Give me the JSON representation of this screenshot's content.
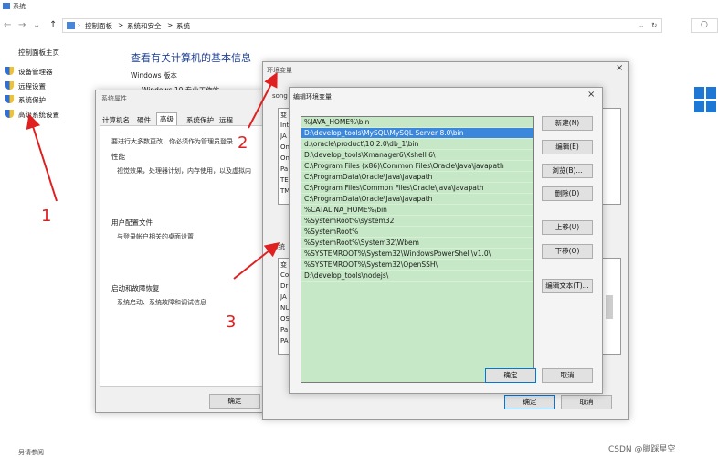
{
  "window": {
    "title": "系统"
  },
  "nav": {
    "back": "←",
    "forward": "→",
    "recent": "⌄",
    "up": "↑",
    "crumbs": [
      "控制面板",
      ">",
      "系统和安全",
      ">",
      "系统"
    ],
    "refresh": "↻",
    "dropdown": "⌄",
    "search": "○"
  },
  "sidebar": {
    "home": "控制面板主页",
    "items": [
      {
        "label": "设备管理器"
      },
      {
        "label": "远程设置"
      },
      {
        "label": "系统保护"
      },
      {
        "label": "高级系统设置"
      }
    ]
  },
  "main": {
    "title": "查看有关计算机的基本信息",
    "edition_label": "Windows 版本",
    "edition_value": "Windows 10 专业工作站",
    "see_also": "另请参阅"
  },
  "sysprops": {
    "title": "系统属性",
    "tabs": [
      "计算机名",
      "硬件",
      "高级",
      "系统保护",
      "远程"
    ],
    "admin_note": "要进行大多数更改，你必须作为管理员登录",
    "perf_label": "性能",
    "perf_text": "视觉效果，处理器计划，内存使用，以及虚拟内",
    "profile_label": "用户配置文件",
    "profile_text": "与登录帐户相关的桌面设置",
    "startup_label": "启动和故障恢复",
    "startup_text": "系统启动、系统故障和调试信息",
    "ok": "确定"
  },
  "envvars": {
    "title": "环境变量",
    "user_prefix": "song",
    "sys_prefix": "系统",
    "user_items": [
      "变",
      "Int",
      "JA",
      "On",
      "On",
      "Pa",
      "TE",
      "TM"
    ],
    "sys_items": [
      "变",
      "Co",
      "Dr",
      "JA",
      "NU",
      "OS",
      "Pa",
      "PA"
    ],
    "ok": "确定",
    "cancel": "取消"
  },
  "editenv": {
    "title": "编辑环境变量",
    "close": "×",
    "entries": [
      "%JAVA_HOME%\\bin",
      "D:\\develop_tools\\MySQL\\MySQL Server 8.0\\bin",
      "d:\\oracle\\product\\10.2.0\\db_1\\bin",
      "D:\\develop_tools\\Xmanager6\\Xshell 6\\",
      "C:\\Program Files (x86)\\Common Files\\Oracle\\Java\\javapath",
      "C:\\ProgramData\\Oracle\\Java\\javapath",
      "C:\\Program Files\\Common Files\\Oracle\\Java\\javapath",
      "C:\\ProgramData\\Oracle\\Java\\javapath",
      "%CATALINA_HOME%\\bin",
      "%SystemRoot%\\system32",
      "%SystemRoot%",
      "%SystemRoot%\\System32\\Wbem",
      "%SYSTEMROOT%\\System32\\WindowsPowerShell\\v1.0\\",
      "%SYSTEMROOT%\\System32\\OpenSSH\\",
      "D:\\develop_tools\\nodejs\\"
    ],
    "selected_index": 1,
    "buttons": {
      "new": "新建(N)",
      "edit": "编辑(E)",
      "browse": "浏览(B)...",
      "delete": "删除(D)",
      "up": "上移(U)",
      "down": "下移(O)",
      "edit_text": "编辑文本(T)..."
    },
    "ok": "确定",
    "cancel": "取消"
  },
  "annotations": [
    "1",
    "2",
    "3"
  ],
  "watermark": "CSDN @脚踩星空",
  "colors": {
    "arrow": "#e02020",
    "list_bg": "#c6e8c6",
    "selection": "#3b87db",
    "title_blue": "#1e3f91"
  }
}
